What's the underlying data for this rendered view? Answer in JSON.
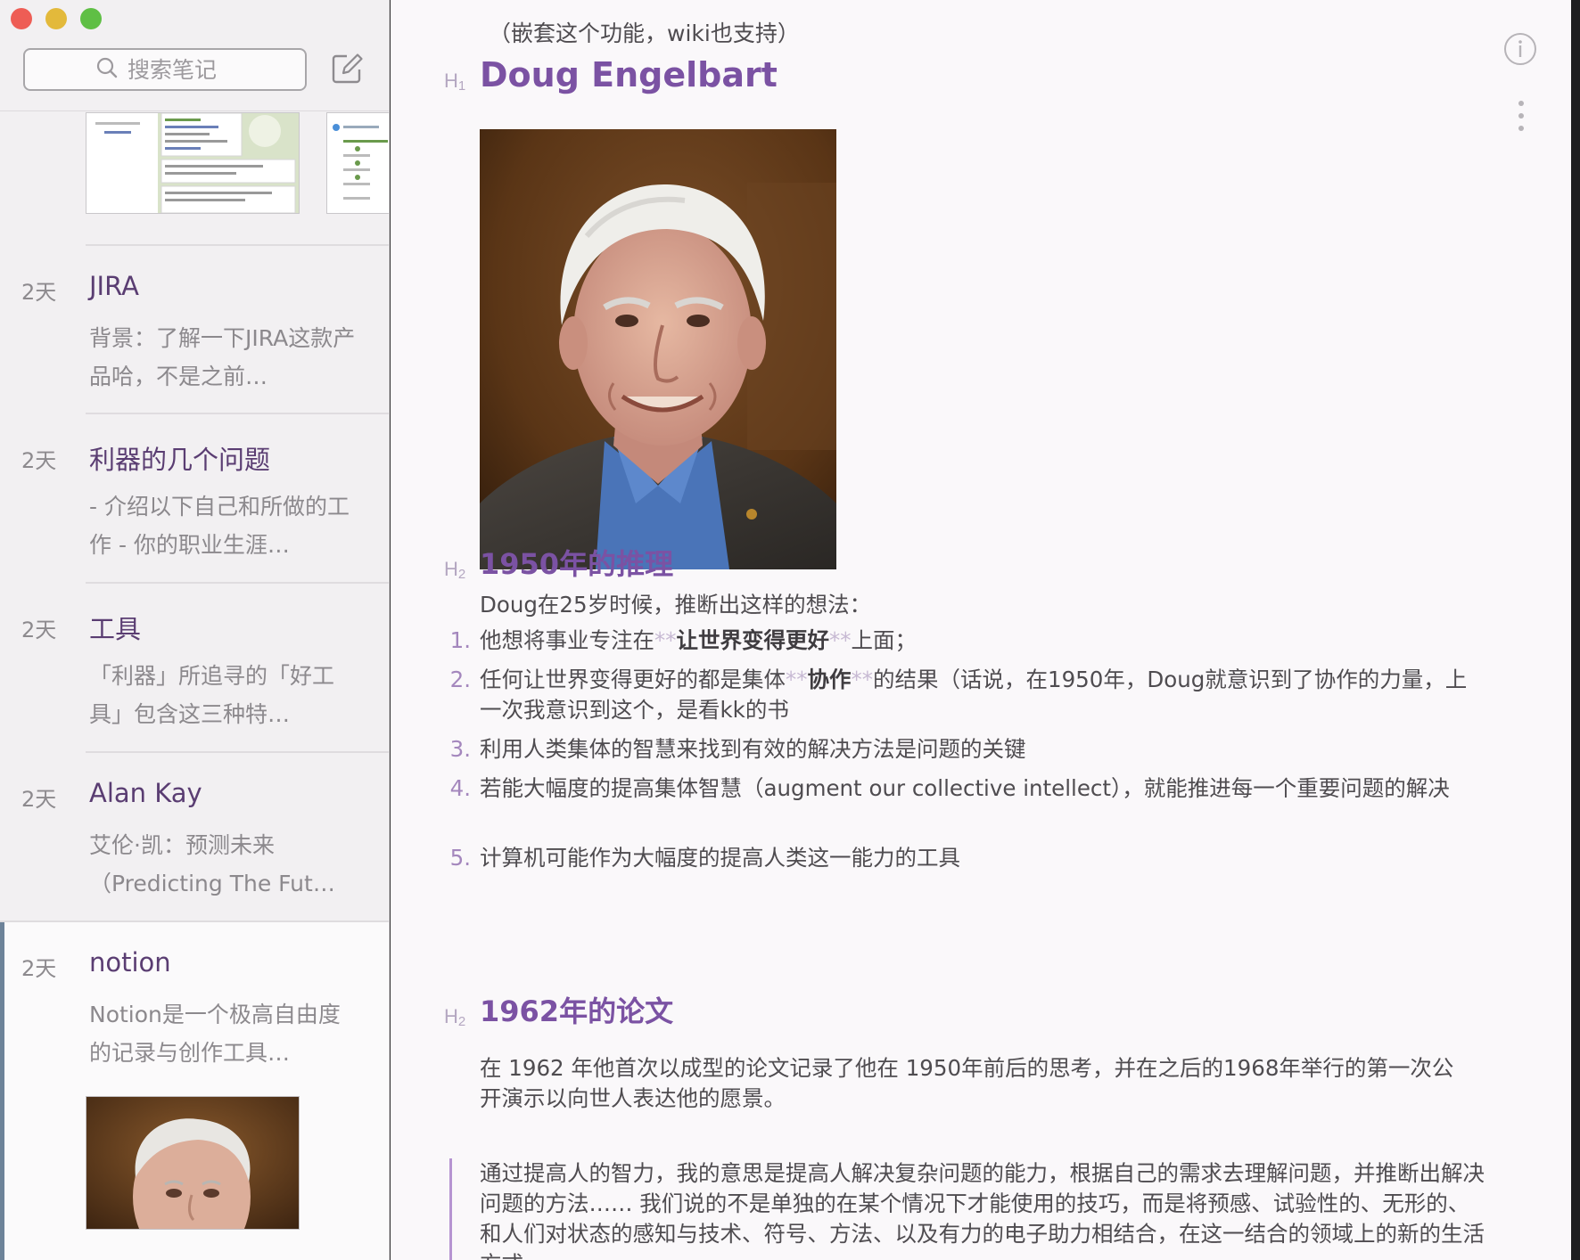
{
  "sidebar": {
    "search_placeholder": "搜索笔记",
    "notes": [
      {
        "age": "2天",
        "title": "JIRA",
        "snippet": "背景：了解一下JIRA这款产品哈，不是之前…"
      },
      {
        "age": "2天",
        "title": "利器的几个问题",
        "snippet": "- 介绍以下自己和所做的工作 - 你的职业生涯…"
      },
      {
        "age": "2天",
        "title": "工具",
        "snippet": "「利器」所追寻的「好工具」包含这三种特…"
      },
      {
        "age": "2天",
        "title": "Alan Kay",
        "snippet": "艾伦·凯：预测未来（Predicting The Fut…"
      },
      {
        "age": "2天",
        "title": "notion",
        "snippet": "Notion是一个极高自由度的记录与创作工具…"
      }
    ]
  },
  "editor": {
    "intro_line": "（嵌套这个功能，wiki也支持）",
    "h1": {
      "marker": "H",
      "level": "1",
      "text": "Doug Engelbart"
    },
    "section1": {
      "marker": "H",
      "level": "2",
      "heading": "1950年的推理",
      "lead": "Doug在25岁时候，推断出这样的想法：",
      "items": [
        {
          "num": "1.",
          "pre": "他想将事业专注在",
          "mk1": "**",
          "bold": "让世界变得更好",
          "mk2": "**",
          "post": "上面；"
        },
        {
          "num": "2.",
          "pre": "任何让世界变得更好的都是集体",
          "mk1": "**",
          "bold": "协作",
          "mk2": "**",
          "post": "的结果（话说，在1950年，Doug就意识到了协作的力量，上一次我意识到这个，是看kk的书"
        },
        {
          "num": "3.",
          "pre": "利用人类集体的智慧来找到有效的解决方法是问题的关键",
          "mk1": "",
          "bold": "",
          "mk2": "",
          "post": ""
        },
        {
          "num": "4.",
          "pre": "若能大幅度的提高集体智慧（augment our collective intellect），就能推进每一个重要问题的解决",
          "mk1": "",
          "bold": "",
          "mk2": "",
          "post": ""
        },
        {
          "num": "5.",
          "pre": "计算机可能作为大幅度的提高人类这一能力的工具",
          "mk1": "",
          "bold": "",
          "mk2": "",
          "post": ""
        }
      ]
    },
    "section2": {
      "marker": "H",
      "level": "2",
      "heading": "1962年的论文",
      "paragraph": "在 1962 年他首次以成型的论文记录了他在 1950年前后的思考，并在之后的1968年举行的第一次公开演示以向世人表达他的愿景。",
      "quote": "通过提高人的智力，我的意思是提高人解决复杂问题的能力，根据自己的需求去理解问题，并推断出解决问题的方法…… 我们说的不是单独的在某个情况下才能使用的技巧，而是将预感、试验性的、无形的、和人们对状态的感知与技术、符号、方法、以及有力的电子助力相结合，在这一结合的领域上的新的生活方式。"
    }
  },
  "colors": {
    "heading": "#7b52a3",
    "note_title": "#5a3d72",
    "selection_bar": "#6d8399",
    "quote_bar": "#b694d1"
  }
}
